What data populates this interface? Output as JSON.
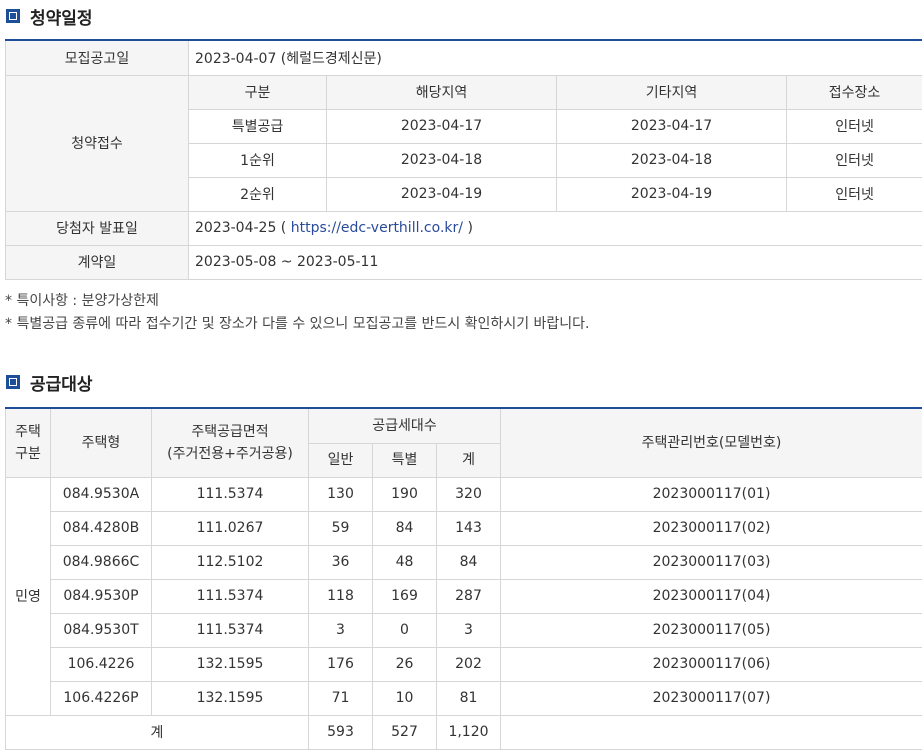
{
  "schedule": {
    "title": "청약일정",
    "announce_label": "모집공고일",
    "announce_value": "2023-04-07 (헤럴드경제신문)",
    "subscription_label": "청약접수",
    "columns": [
      "구분",
      "해당지역",
      "기타지역",
      "접수장소"
    ],
    "rows": [
      [
        "특별공급",
        "2023-04-17",
        "2023-04-17",
        "인터넷"
      ],
      [
        "1순위",
        "2023-04-18",
        "2023-04-18",
        "인터넷"
      ],
      [
        "2순위",
        "2023-04-19",
        "2023-04-19",
        "인터넷"
      ]
    ],
    "winner_label": "당첨자 발표일",
    "winner_date": "2023-04-25 (",
    "winner_link": "https://edc-verthill.co.kr/",
    "winner_close": ")",
    "contract_label": "계약일",
    "contract_value": "2023-05-08 ~ 2023-05-11"
  },
  "notes": [
    "* 특이사항 : 분양가상한제",
    "* 특별공급 종류에 따라 접수기간 및 장소가 다를 수 있으니 모집공고를 반드시 확인하시기 바랍니다."
  ],
  "supply": {
    "title": "공급대상",
    "headers": {
      "housing_type_line1": "주택",
      "housing_type_line2": "구분",
      "model": "주택형",
      "area_line1": "주택공급면적",
      "area_line2": "(주거전용+주거공용)",
      "units": "공급세대수",
      "general": "일반",
      "special": "특별",
      "total": "계",
      "mgmt_no": "주택관리번호(모델번호)"
    },
    "category": "민영",
    "rows": [
      [
        "084.9530A",
        "111.5374",
        "130",
        "190",
        "320",
        "2023000117(01)"
      ],
      [
        "084.4280B",
        "111.0267",
        "59",
        "84",
        "143",
        "2023000117(02)"
      ],
      [
        "084.9866C",
        "112.5102",
        "36",
        "48",
        "84",
        "2023000117(03)"
      ],
      [
        "084.9530P",
        "111.5374",
        "118",
        "169",
        "287",
        "2023000117(04)"
      ],
      [
        "084.9530T",
        "111.5374",
        "3",
        "0",
        "3",
        "2023000117(05)"
      ],
      [
        "106.4226",
        "132.1595",
        "176",
        "26",
        "202",
        "2023000117(06)"
      ],
      [
        "106.4226P",
        "132.1595",
        "71",
        "10",
        "81",
        "2023000117(07)"
      ]
    ],
    "total_label": "계",
    "total_general": "593",
    "total_special": "527",
    "total_all": "1,120"
  }
}
